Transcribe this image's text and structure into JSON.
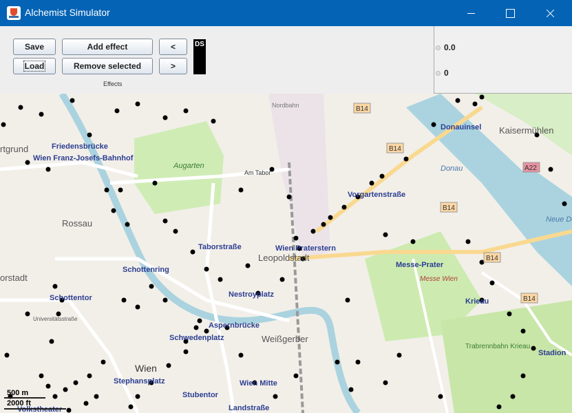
{
  "window": {
    "title": "Alchemist Simulator"
  },
  "toolbar": {
    "save_label": "Save",
    "load_label": "Load",
    "add_effect_label": "Add effect",
    "remove_selected_label": "Remove selected",
    "prev_label": "<",
    "next_label": ">",
    "ds_label": "DS",
    "effects_label": "Effects"
  },
  "right_panel": {
    "value_1": "0.0",
    "value_2": "0"
  },
  "map": {
    "labels": [
      "Friedensbrücke",
      "Wien Franz-Josefs-Bahnhof",
      "Rossau",
      "Augarten",
      "Am Tabor",
      "Taborstraße",
      "Schottenring",
      "Schottentor",
      "Nestroyplatz",
      "Aspernbrücke",
      "Schwedenplatz",
      "Wien Praterstern",
      "Leopoldstadt",
      "Vorgartenstraße",
      "Messe-Prater",
      "Messe Wien",
      "Krieau",
      "Donauinsel",
      "Kaisermühlen",
      "Donau",
      "Neue Donau",
      "Weißgerber",
      "Wien",
      "Stephansplatz",
      "Stubentor",
      "Wien Mitte",
      "Landstraße",
      "Volkstheater",
      "Trabrennbahn Krieau",
      "Stadion",
      "Nordbahn",
      "B14",
      "A22",
      "Universitätsstraße",
      "rtgrund",
      "orstadt"
    ],
    "scale_m": "500 m",
    "scale_ft": "2000 ft"
  }
}
